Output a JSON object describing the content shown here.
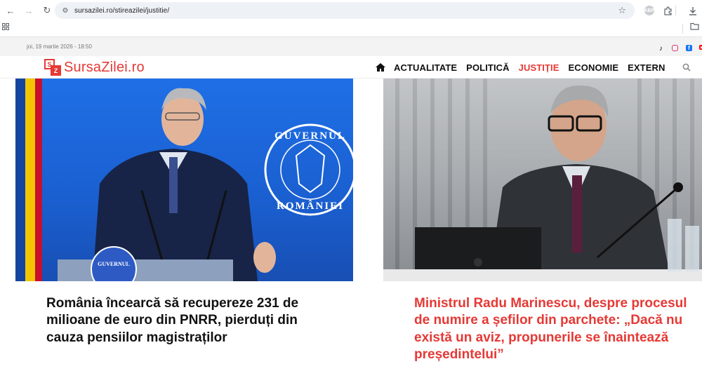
{
  "browser": {
    "url": "sursazilei.ro/stireazilei/justitie/"
  },
  "site": {
    "date": "joi, 19 martie 2026 - 18:50",
    "logo": {
      "mark_top": "S",
      "mark_bottom": "Z",
      "text": "SursaZilei.ro",
      "color": "#e53935"
    },
    "nav": {
      "items": [
        {
          "label": "ACTUALITATE"
        },
        {
          "label": "POLITICĂ"
        },
        {
          "label": "JUSTIȚIE",
          "active": true
        },
        {
          "label": "ECONOMIE"
        },
        {
          "label": "EXTERN"
        }
      ],
      "active_color": "#e53935"
    },
    "social_icons": [
      "tiktok-icon",
      "instagram-icon",
      "facebook-icon",
      "youtube-icon"
    ]
  },
  "articles": [
    {
      "headline": "România încearcă să recupereze 231 de milioane de euro din PNRR, pierduți din cauza pensiilor magistraților",
      "image": {
        "seal_top": "GUVERNUL",
        "seal_bottom": "ROMÂNIEI",
        "podium_seal": "GUVERNUL"
      }
    },
    {
      "headline": "Ministrul Radu Marinescu, despre procesul de numire a șefilor din parchete: „Dacă nu există un aviz, propunerile se înaintează președintelui”",
      "headline_color": "#e53935"
    }
  ]
}
